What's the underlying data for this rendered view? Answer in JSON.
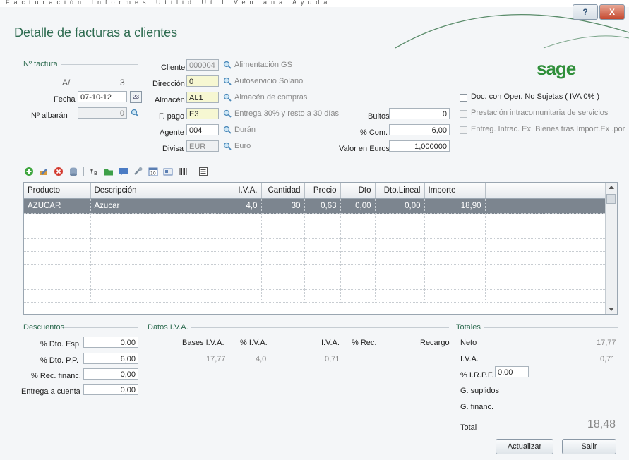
{
  "window": {
    "title": "Detalle de facturas a clientes",
    "menu_ghost": "Facturación  Informes  Utilid  Util  Ventana  Ayuda",
    "help_label": "?",
    "close_label": "X"
  },
  "logo": "sage",
  "factura": {
    "section_title": "Nº factura",
    "serie": "A/",
    "numero": "3",
    "fecha_label": "Fecha",
    "fecha_value": "07-10-12",
    "calendar_label": "23",
    "albaran_label": "Nº albarán",
    "albaran_value": "0"
  },
  "cliente": {
    "cliente_label": "Cliente",
    "cliente_value": "000004",
    "cliente_desc": "Alimentación GS",
    "direccion_label": "Dirección",
    "direccion_value": "0",
    "direccion_desc": "Autoservicio Solano",
    "almacen_label": "Almacén",
    "almacen_value": "AL1",
    "almacen_desc": "Almacén de compras",
    "fpago_label": "F. pago",
    "fpago_value": "E3",
    "fpago_desc": "Entrega 30% y resto a 30 días",
    "agente_label": "Agente",
    "agente_value": "004",
    "agente_desc": "Durán",
    "divisa_label": "Divisa",
    "divisa_value": "EUR",
    "divisa_desc": "Euro"
  },
  "extra": {
    "bultos_label": "Bultos",
    "bultos_value": "0",
    "com_label": "% Com.",
    "com_value": "6,00",
    "valor_label": "Valor en Euros",
    "valor_value": "1,000000"
  },
  "checks": [
    {
      "label": "Doc. con Oper. No Sujetas ( IVA 0% )",
      "enabled": true
    },
    {
      "label": "Prestación intracomunitaria de servicios",
      "enabled": false
    },
    {
      "label": "Entreg. Intrac. Ex. Bienes tras Import.Ex .por",
      "enabled": false
    }
  ],
  "grid": {
    "columns": [
      "Producto",
      "Descripción",
      "I.V.A.",
      "Cantidad",
      "Precio",
      "Dto",
      "Dto.Lineal",
      "Importe"
    ],
    "rows": [
      [
        "AZUCAR",
        "Azucar",
        "4,0",
        "30",
        "0,63",
        "0,00",
        "0,00",
        "18,90"
      ]
    ]
  },
  "descuentos": {
    "section_title": "Descuentos",
    "items": [
      {
        "label": "% Dto. Esp.",
        "value": "0,00"
      },
      {
        "label": "% Dto. P.P.",
        "value": "6,00"
      },
      {
        "label": "% Rec. financ.",
        "value": "0,00"
      },
      {
        "label": "Entrega a cuenta",
        "value": "0,00"
      }
    ]
  },
  "iva": {
    "section_title": "Datos I.V.A.",
    "headers": [
      "Bases I.V.A.",
      "% I.V.A.",
      "I.V.A.",
      "% Rec.",
      "Recargo"
    ],
    "row": [
      "17,77",
      "4,0",
      "0,71"
    ]
  },
  "totales": {
    "section_title": "Totales",
    "neto_label": "Neto",
    "neto_value": "17,77",
    "iva_label": "I.V.A.",
    "iva_value": "0,71",
    "irpf_label": "% I.R.P.F.",
    "irpf_value": "0,00",
    "suplidos_label": "G. suplidos",
    "financ_label": "G. financ.",
    "total_label": "Total",
    "total_value": "18,48"
  },
  "buttons": {
    "actualizar": "Actualizar",
    "salir": "Salir"
  },
  "colors": {
    "accent_green": "#2d6b50",
    "selected_row": "#7c858f",
    "field_yellow": "#f6f7d2"
  }
}
